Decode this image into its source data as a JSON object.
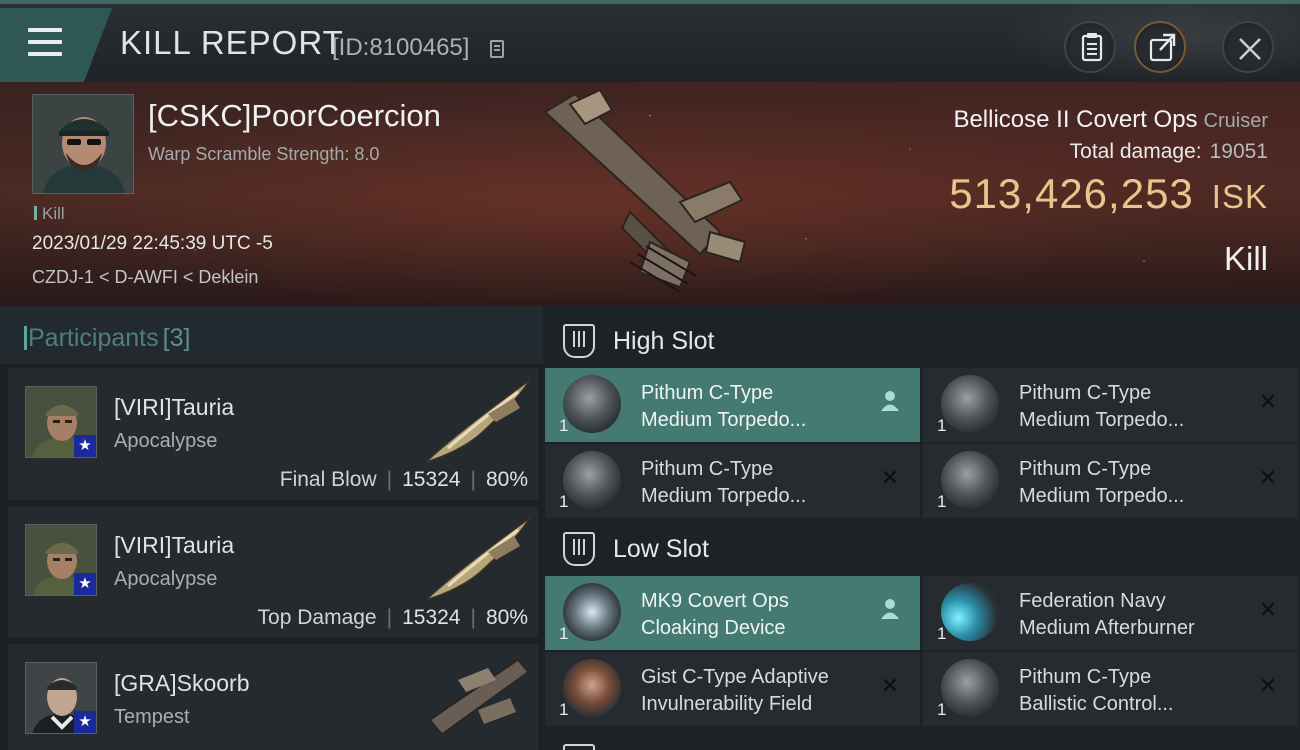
{
  "header": {
    "title": "KILL REPORT",
    "report_id": "[ID:8100465]",
    "icons": [
      "menu-icon",
      "copy-icon",
      "clipboard-icon",
      "share-icon",
      "close-icon"
    ]
  },
  "victim": {
    "name": "[CSKC]PoorCoercion",
    "stat": "Warp Scramble Strength: 8.0",
    "tag": "Kill",
    "datetime": "2023/01/29 22:45:39 UTC -5",
    "location": "CZDJ-1 < D-AWFI < Deklein"
  },
  "ship": {
    "name": "Bellicose II Covert Ops",
    "class": "Cruiser",
    "total_damage_label": "Total damage:",
    "total_damage": "19051",
    "isk_value": "513,426,253",
    "isk_unit": "ISK",
    "result": "Kill"
  },
  "participants": {
    "title": "Participants",
    "count": "[3]",
    "items": [
      {
        "name": "[VIRI]Tauria",
        "ship": "Apocalypse",
        "label": "Final Blow",
        "damage": "15324",
        "percent": "80%"
      },
      {
        "name": "[VIRI]Tauria",
        "ship": "Apocalypse",
        "label": "Top Damage",
        "damage": "15324",
        "percent": "80%"
      },
      {
        "name": "[GRA]Skoorb",
        "ship": "Tempest"
      }
    ]
  },
  "fittings": {
    "high_slot": {
      "title": "High Slot",
      "modules": [
        {
          "line1": "Pithum C-Type",
          "line2": "Medium Torpedo...",
          "qty": "1",
          "status": "dropped"
        },
        {
          "line1": "Pithum C-Type",
          "line2": "Medium Torpedo...",
          "qty": "1",
          "status": "destroyed"
        },
        {
          "line1": "Pithum C-Type",
          "line2": "Medium Torpedo...",
          "qty": "1",
          "status": "destroyed"
        },
        {
          "line1": "Pithum C-Type",
          "line2": "Medium Torpedo...",
          "qty": "1",
          "status": "destroyed"
        }
      ]
    },
    "low_slot": {
      "title": "Low Slot",
      "modules": [
        {
          "line1": "MK9 Covert Ops",
          "line2": "Cloaking Device",
          "qty": "1",
          "status": "dropped"
        },
        {
          "line1": "Federation Navy",
          "line2": "Medium Afterburner",
          "qty": "1",
          "status": "destroyed"
        },
        {
          "line1": "Gist C-Type Adaptive",
          "line2": "Invulnerability Field",
          "qty": "1",
          "status": "destroyed"
        },
        {
          "line1": "Pithum C-Type",
          "line2": "Ballistic Control...",
          "qty": "1",
          "status": "destroyed"
        }
      ]
    }
  },
  "colors": {
    "accent_teal": "#457a72",
    "isk_gold": "#e9c58c",
    "background": "#14181c"
  }
}
